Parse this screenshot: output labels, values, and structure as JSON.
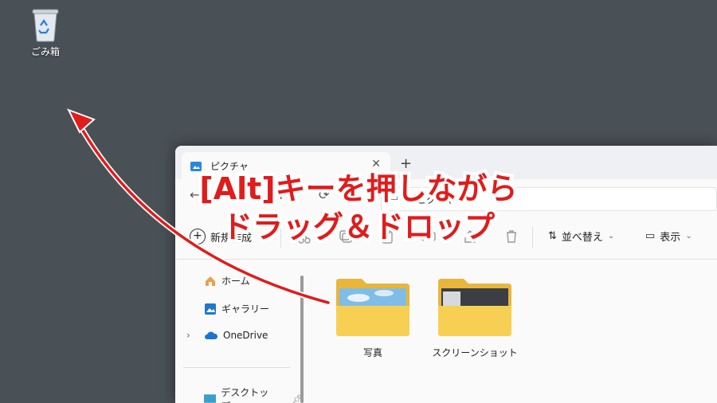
{
  "desktop": {
    "recycle_bin_label": "ごみ箱"
  },
  "window": {
    "tab_title": "ピクチャ",
    "new_tab": "+",
    "tab_close": "✕",
    "address": {
      "current": "ピクチャ"
    },
    "toolbar": {
      "new_label": "新規作成",
      "sort_label": "並べ替え",
      "view_label": "表示"
    },
    "nav": {
      "items": [
        {
          "label": "ホーム",
          "icon": "home-icon"
        },
        {
          "label": "ギャラリー",
          "icon": "gallery-icon"
        },
        {
          "label": "OneDrive",
          "icon": "cloud-icon"
        },
        {
          "label": "デスクトップ",
          "icon": "desktop-icon"
        }
      ]
    },
    "folders": [
      {
        "label": "写真"
      },
      {
        "label": "スクリーンショット"
      }
    ]
  },
  "annotation": {
    "line1": "[Alt]キーを押しながら",
    "line2": "ドラッグ＆ドロップ",
    "color": "#e01c1c"
  }
}
